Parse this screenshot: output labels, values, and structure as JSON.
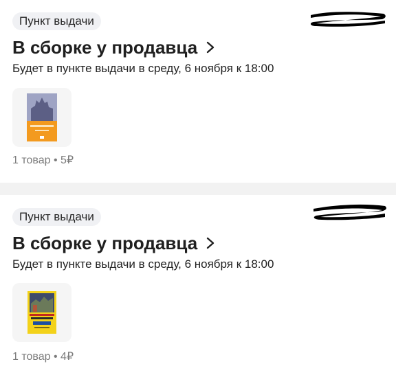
{
  "orders": [
    {
      "badge": "Пункт выдачи",
      "title": "В сборке у продавца",
      "subtitle": "Будет в пункте выдачи в среду, 6 ноября к 18:00",
      "meta": "1 товар • 5₽"
    },
    {
      "badge": "Пункт выдачи",
      "title": "В сборке у продавца",
      "subtitle": "Будет в пункте выдачи в среду, 6 ноября к 18:00",
      "meta": "1 товар • 4₽"
    }
  ],
  "colors": {
    "badge_bg": "#f0f1f4",
    "separator": "#f2f2f2",
    "meta_text": "#7b7b7b",
    "redaction": "#000000"
  },
  "icons": {
    "chevron": "chevron-right-icon"
  }
}
